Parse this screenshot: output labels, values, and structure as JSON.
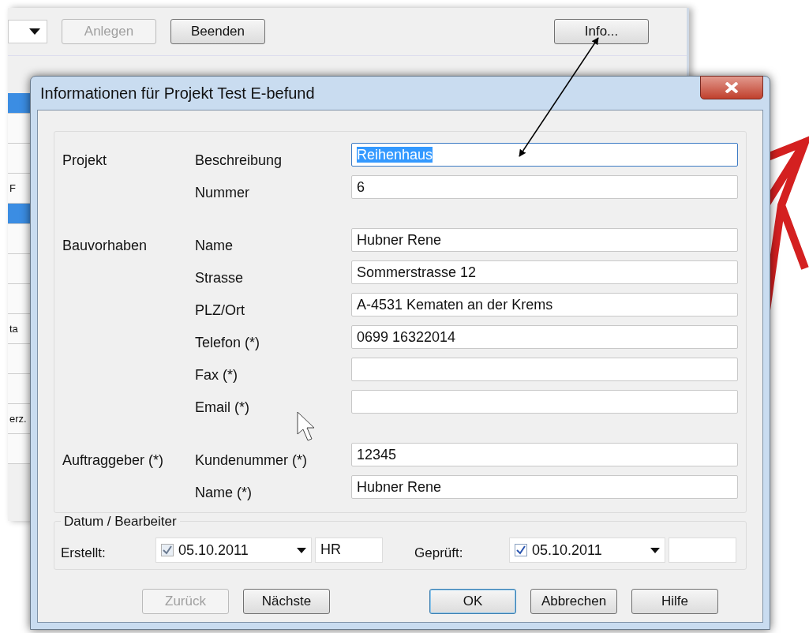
{
  "background_window": {
    "buttons": [
      {
        "label": "Anlegen",
        "disabled": true
      },
      {
        "label": "Beenden",
        "disabled": false
      },
      {
        "label": "Info...",
        "disabled": false
      }
    ],
    "list_rows": [
      {
        "selected": true
      },
      {
        "selected": false
      },
      {
        "selected": false
      },
      {
        "text": "F",
        "selected": false
      },
      {
        "selected": true
      },
      {
        "selected": false
      },
      {
        "selected": false
      },
      {
        "selected": false
      },
      {
        "text": "ta",
        "selected": false
      },
      {
        "selected": false
      },
      {
        "selected": false
      },
      {
        "text": "erz.",
        "selected": false
      },
      {
        "selected": false
      }
    ]
  },
  "dialog": {
    "title": "Informationen für Projekt Test E-befund",
    "sections": [
      {
        "label": "Projekt",
        "fields": [
          {
            "label": "Beschreibung",
            "value": "Reihenhaus",
            "focused": true
          },
          {
            "label": "Nummer",
            "value": "6",
            "focused": false
          }
        ]
      },
      {
        "label": "Bauvorhaben",
        "fields": [
          {
            "label": "Name",
            "value": "Hubner Rene",
            "focused": false
          },
          {
            "label": "Strasse",
            "value": "Sommerstrasse 12",
            "focused": false
          },
          {
            "label": "PLZ/Ort",
            "value": "A-4531 Kematen an der Krems",
            "focused": false
          },
          {
            "label": "Telefon (*)",
            "value": "0699 16322014",
            "focused": false
          },
          {
            "label": "Fax (*)",
            "focused": false
          },
          {
            "label": "Email (*)",
            "focused": false
          }
        ]
      },
      {
        "label": "Auftraggeber (*)",
        "fields": [
          {
            "label": "Kundenummer (*)",
            "value": "12345",
            "focused": false
          },
          {
            "label": "Name (*)",
            "value": "Hubner Rene",
            "focused": false
          }
        ]
      }
    ],
    "dates": {
      "title": "Datum / Bearbeiter",
      "entries": [
        {
          "label": "Erstellt:",
          "checked": true,
          "disabled": true,
          "date": "05.10.2011",
          "initials": "HR"
        },
        {
          "label": "Geprüft:",
          "checked": true,
          "disabled": false,
          "date": "05.10.2011"
        }
      ]
    },
    "buttons": [
      {
        "label": "Zurück",
        "disabled": true,
        "default": false
      },
      {
        "label": "Nächste",
        "disabled": false,
        "default": false
      },
      {
        "label": "OK",
        "disabled": false,
        "default": true
      },
      {
        "label": "Abbrechen",
        "disabled": false,
        "default": false
      },
      {
        "label": "Hilfe",
        "disabled": false,
        "default": false
      }
    ]
  }
}
